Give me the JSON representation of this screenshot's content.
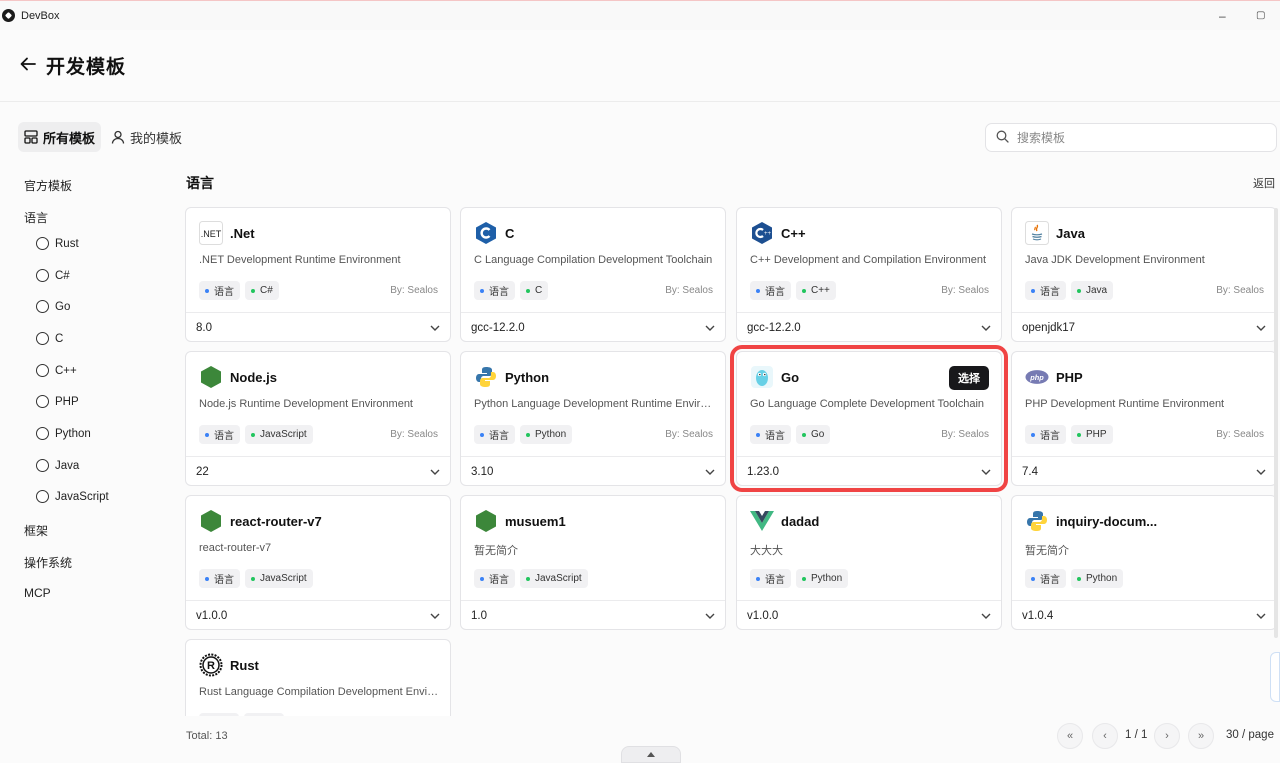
{
  "window": {
    "title": "DevBox",
    "minimize": "–",
    "maximize": "▢"
  },
  "header": {
    "title": "开发模板"
  },
  "tabs": [
    {
      "label": "所有模板"
    },
    {
      "label": "我的模板"
    }
  ],
  "search": {
    "placeholder": "搜索模板"
  },
  "sidebar": {
    "official": "官方模板",
    "language": "语言",
    "languages": [
      "Rust",
      "C#",
      "Go",
      "C",
      "C++",
      "PHP",
      "Python",
      "Java",
      "JavaScript"
    ],
    "framework": "框架",
    "os": "操作系统",
    "mcp": "MCP"
  },
  "section": {
    "title": "语言",
    "back": "返回"
  },
  "cards": [
    {
      "name": ".Net",
      "desc": ".NET Development Runtime Environment",
      "tag1": "语言",
      "tag2": "C#",
      "by": "By: Sealos",
      "version": "8.0",
      "icon": "dotnet-icon"
    },
    {
      "name": "C",
      "desc": "C Language Compilation Development Toolchain",
      "tag1": "语言",
      "tag2": "C",
      "by": "By: Sealos",
      "version": "gcc-12.2.0",
      "icon": "c-icon"
    },
    {
      "name": "C++",
      "desc": "C++ Development and Compilation Environment",
      "tag1": "语言",
      "tag2": "C++",
      "by": "By: Sealos",
      "version": "gcc-12.2.0",
      "icon": "cpp-icon"
    },
    {
      "name": "Java",
      "desc": "Java JDK Development Environment",
      "tag1": "语言",
      "tag2": "Java",
      "by": "By: Sealos",
      "version": "openjdk17",
      "icon": "java-icon"
    },
    {
      "name": "Node.js",
      "desc": "Node.js Runtime Development Environment",
      "tag1": "语言",
      "tag2": "JavaScript",
      "by": "By: Sealos",
      "version": "22",
      "icon": "nodejs-icon"
    },
    {
      "name": "Python",
      "desc": "Python Language Development Runtime Environment",
      "tag1": "语言",
      "tag2": "Python",
      "by": "By: Sealos",
      "version": "3.10",
      "icon": "python-icon"
    },
    {
      "name": "Go",
      "desc": "Go Language Complete Development Toolchain",
      "tag1": "语言",
      "tag2": "Go",
      "by": "By: Sealos",
      "version": "1.23.0",
      "icon": "go-icon",
      "select": "选择"
    },
    {
      "name": "PHP",
      "desc": "PHP Development Runtime Environment",
      "tag1": "语言",
      "tag2": "PHP",
      "by": "By: Sealos",
      "version": "7.4",
      "icon": "php-icon"
    },
    {
      "name": "react-router-v7",
      "desc": "react-router-v7",
      "tag1": "语言",
      "tag2": "JavaScript",
      "by": "",
      "version": "v1.0.0",
      "icon": "nodejs-icon"
    },
    {
      "name": "musuem1",
      "desc": "暂无简介",
      "tag1": "语言",
      "tag2": "JavaScript",
      "by": "",
      "version": "1.0",
      "icon": "nodejs-icon"
    },
    {
      "name": "dadad",
      "desc": "大大大",
      "tag1": "语言",
      "tag2": "Python",
      "by": "",
      "version": "v1.0.0",
      "icon": "vue-icon"
    },
    {
      "name": "inquiry-docum...",
      "desc": "暂无简介",
      "tag1": "语言",
      "tag2": "Python",
      "by": "",
      "version": "v1.0.4",
      "icon": "python-icon"
    },
    {
      "name": "Rust",
      "desc": "Rust Language Compilation Development Environment",
      "icon": "rust-icon"
    }
  ],
  "footer": {
    "total": "Total: 13",
    "page": "1 / 1",
    "per_page": "30 / page"
  }
}
